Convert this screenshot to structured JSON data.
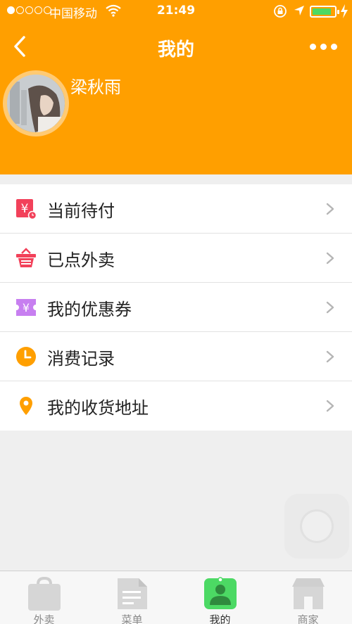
{
  "status_bar": {
    "carrier": "中国移动",
    "time": "21:49"
  },
  "header": {
    "title": "我的",
    "username": "梁秋雨"
  },
  "menu": [
    {
      "label": "当前待付",
      "icon": "unpaid-icon"
    },
    {
      "label": "已点外卖",
      "icon": "basket-icon"
    },
    {
      "label": "我的优惠券",
      "icon": "coupon-icon"
    },
    {
      "label": "消费记录",
      "icon": "clock-icon"
    },
    {
      "label": "我的收货地址",
      "icon": "location-pin-icon"
    }
  ],
  "tabs": [
    {
      "label": "外卖",
      "icon": "bag-icon",
      "active": false
    },
    {
      "label": "菜单",
      "icon": "document-icon",
      "active": false
    },
    {
      "label": "我的",
      "icon": "person-icon",
      "active": true
    },
    {
      "label": "商家",
      "icon": "store-icon",
      "active": false
    }
  ],
  "colors": {
    "brand": "#ff9f00",
    "active_tab": "#4cd964",
    "unpaid_icon": "#f2415a",
    "coupon_icon": "#c77ff0",
    "clock_icon": "#ff9f00",
    "pin_icon": "#ff9f00"
  }
}
